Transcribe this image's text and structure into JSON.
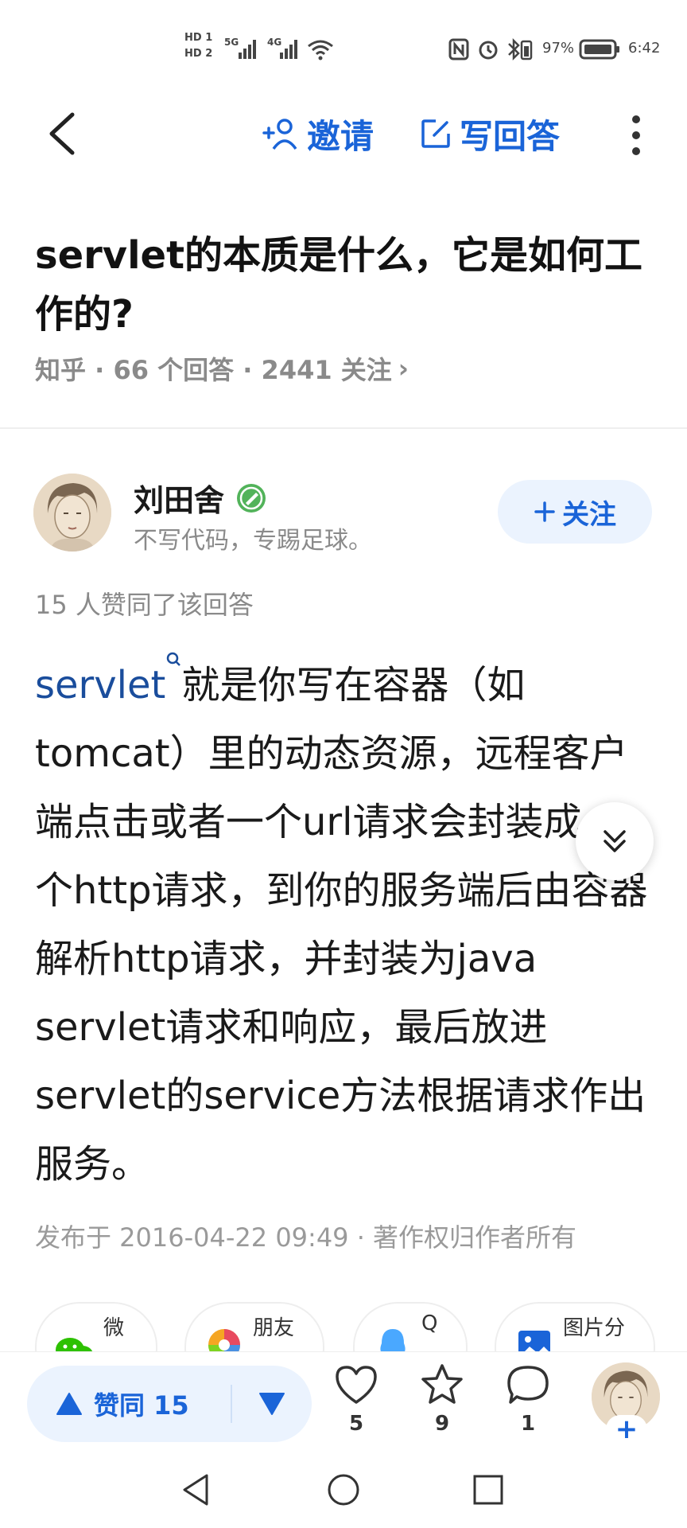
{
  "status_bar": {
    "battery": "97%",
    "time": "6:42",
    "network_1": "5G",
    "network_2": "4G",
    "hd_1": "HD 1",
    "hd_2": "HD 2"
  },
  "header": {
    "invite_label": "邀请",
    "write_answer_label": "写回答"
  },
  "question": {
    "title": "servlet的本质是什么，它是如何工作的?",
    "meta": "知乎 · 66 个回答 · 2441 关注",
    "meta_chevron": "›"
  },
  "author": {
    "name": "刘田舍",
    "bio": "不写代码，专踢足球。",
    "follow_label": "关注"
  },
  "answer": {
    "agree_text": "15 人赞同了该回答",
    "keyword": "servlet",
    "body": "就是你写在容器（如tomcat）里的动态资源，远程客户端点击或者一个url请求会封装成一个http请求，到你的服务端后由容器解析http请求，并封装为java servlet请求和响应，最后放进servlet的service方法根据请求作出服务。",
    "published": "发布于 2016-04-22 09:49 · 著作权归作者所有"
  },
  "share": [
    {
      "label": "微",
      "icon": "wechat-icon"
    },
    {
      "label": "朋友",
      "icon": "moments-icon"
    },
    {
      "label": "Q",
      "icon": "qq-icon"
    },
    {
      "label": "图片分",
      "icon": "image-share-icon"
    }
  ],
  "bottom_bar": {
    "vote_label": "赞同 15",
    "like_count": "5",
    "favorite_count": "9",
    "comment_count": "1",
    "create_plus": "+"
  },
  "colors": {
    "accent": "#1a64d8",
    "keyword": "#1a4d9c",
    "follow_bg": "#ebf3fe",
    "muted": "#8a8a8a"
  }
}
